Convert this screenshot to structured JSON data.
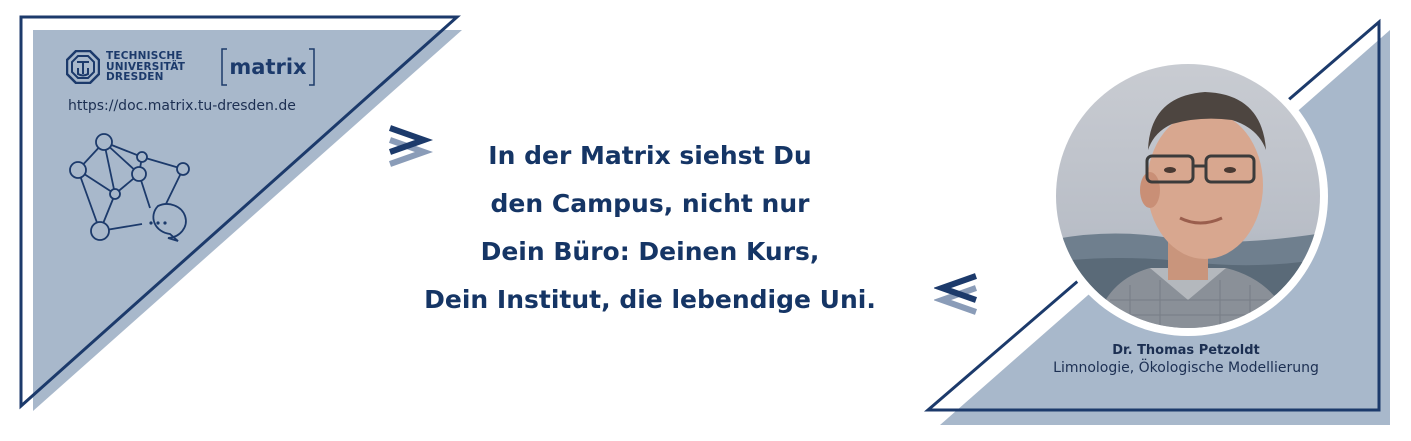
{
  "logos": {
    "tu_lines": [
      "TECHNISCHE",
      "UNIVERSITÄT",
      "DRESDEN"
    ],
    "matrix": "matrix"
  },
  "url": "https://doc.matrix.tu-dresden.de",
  "quote": {
    "lines": [
      "In der Matrix siehst Du",
      "den Campus, nicht nur",
      "Dein Büro: Deinen Kurs,",
      "Dein Institut, die lebendige Uni."
    ]
  },
  "person": {
    "name": "Dr. Thomas Petzoldt",
    "role": "Limnologie, Ökologische Modellierung"
  },
  "icons": [
    "network-chat-icon",
    "quote-open-icon",
    "quote-close-icon",
    "tu-dresden-logo-icon"
  ],
  "colors": {
    "panel": "#a8b8cb",
    "navy": "#153565",
    "border": "#1c3a6b",
    "accent_light": "#8a9cb8"
  }
}
